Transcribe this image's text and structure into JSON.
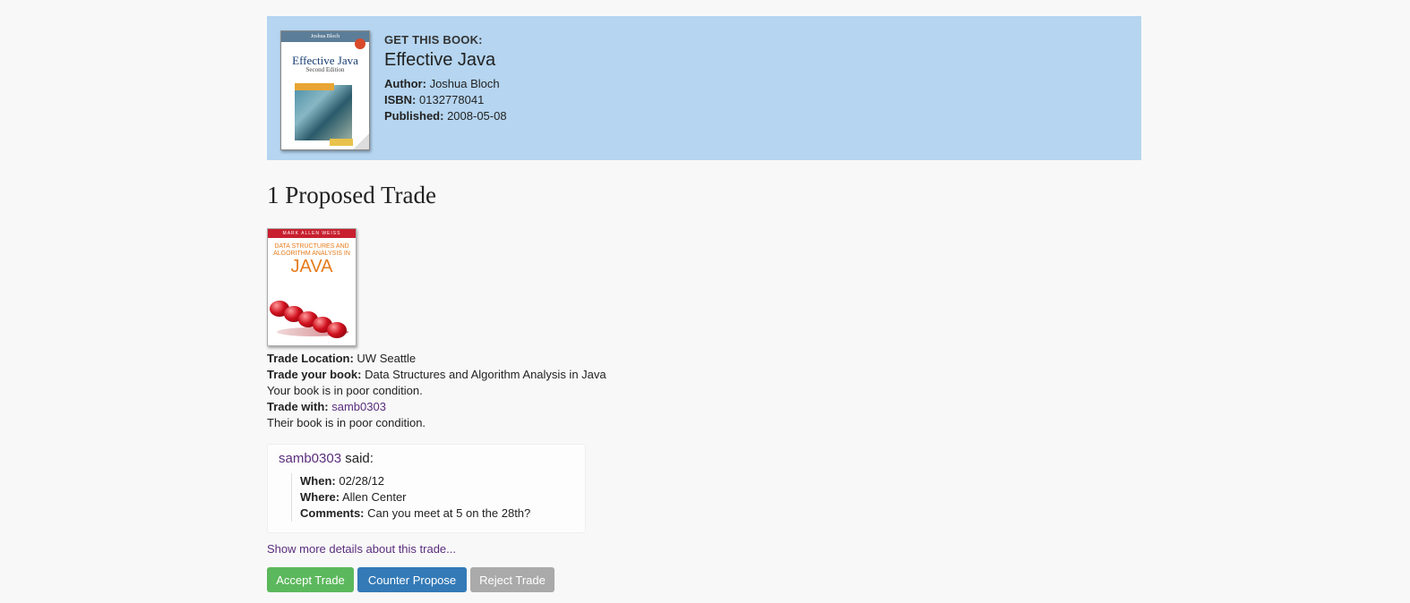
{
  "book": {
    "get_label": "GET THIS BOOK:",
    "title": "Effective Java",
    "author_label": "Author:",
    "author": "Joshua Bloch",
    "isbn_label": "ISBN:",
    "isbn": "0132778041",
    "published_label": "Published:",
    "published": "2008-05-08",
    "cover": {
      "top_text": "Joshua Bloch",
      "title": "Effective Java",
      "subtitle": "Second Edition"
    }
  },
  "section_title": "1 Proposed Trade",
  "trade": {
    "cover": {
      "top_text": "MARK ALLEN WEISS",
      "title": "DATA STRUCTURES AND ALGORITHM ANALYSIS IN",
      "java": "JAVA"
    },
    "location_label": "Trade Location:",
    "location": "UW Seattle",
    "your_book_label": "Trade your book:",
    "your_book": "Data Structures and Algorithm Analysis in Java",
    "your_condition": "Your book is in poor condition.",
    "trade_with_label": "Trade with:",
    "trade_with": "samb0303",
    "their_condition": "Their book is in poor condition."
  },
  "comment": {
    "user": "samb0303",
    "said": "said:",
    "when_label": "When:",
    "when": "02/28/12",
    "where_label": "Where:",
    "where": "Allen Center",
    "comments_label": "Comments:",
    "comments": "Can you meet at 5 on the 28th?"
  },
  "more_link": "Show more details about this trade...",
  "buttons": {
    "accept": "Accept Trade",
    "counter": "Counter Propose",
    "reject": "Reject Trade"
  },
  "colors": {
    "banner": "#b5d5f0",
    "accept": "#5cb85c",
    "counter": "#337ab7",
    "reject": "#aaaaaa",
    "link": "#5a2d7d"
  }
}
